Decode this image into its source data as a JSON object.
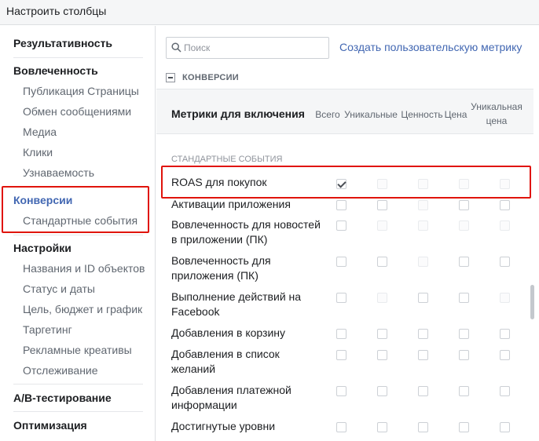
{
  "header": {
    "title": "Настроить столбцы"
  },
  "sidebar": {
    "sections": [
      {
        "label": "Результативность",
        "items": []
      },
      {
        "label": "Вовлеченность",
        "items": [
          "Публикация Страницы",
          "Обмен сообщениями",
          "Медиа",
          "Клики",
          "Узнаваемость"
        ]
      },
      {
        "label": "Конверсии",
        "items": [
          "Стандартные события"
        ]
      },
      {
        "label": "Настройки",
        "items": [
          "Названия и ID объектов",
          "Статус и даты",
          "Цель, бюджет и график",
          "Таргетинг",
          "Рекламные креативы",
          "Отслеживание"
        ]
      },
      {
        "label": "A/B-тестирование",
        "items": []
      },
      {
        "label": "Оптимизация",
        "items": []
      }
    ]
  },
  "main": {
    "search": {
      "placeholder": "Поиск",
      "value": ""
    },
    "custom_metric_link": "Создать пользовательскую метрику",
    "section_label": "КОНВЕРСИИ",
    "metrics_title": "Метрики для включения",
    "columns": [
      "Всего",
      "Уникальные",
      "Ценность",
      "Цена",
      "Уникальная цена"
    ],
    "subsection_label": "СТАНДАРТНЫЕ СОБЫТИЯ",
    "rows": [
      {
        "label": "ROAS для покупок",
        "total_checked": true
      },
      {
        "label": "Активации приложения",
        "total_checked": false
      },
      {
        "label": "Вовлеченность для новостей в приложении (ПК)",
        "total_checked": false
      },
      {
        "label": "Вовлеченность для приложения (ПК)",
        "total_checked": false
      },
      {
        "label": "Выполнение действий на Facebook",
        "total_checked": false
      },
      {
        "label": "Добавления в корзину",
        "total_checked": false
      },
      {
        "label": "Добавления в список желаний",
        "total_checked": false
      },
      {
        "label": "Добавления платежной информации",
        "total_checked": false
      },
      {
        "label": "Достигнутые уровни",
        "total_checked": false
      }
    ]
  },
  "colors": {
    "accent": "#4267b2",
    "highlight_border": "#e0140c",
    "header_bg": "#f5f6f7"
  }
}
